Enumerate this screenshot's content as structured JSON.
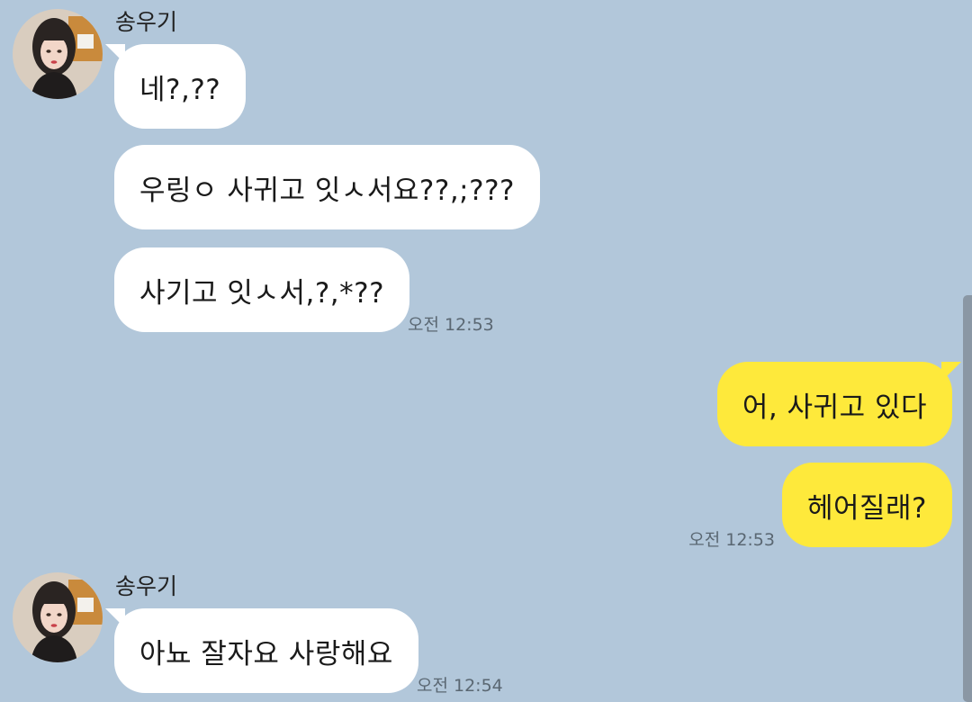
{
  "chat": {
    "groups": [
      {
        "sender": "송우기",
        "messages": [
          "네?,??",
          "우링ㅇ 사귀고 잇ㅅ서요??,;???",
          "사기고 잇ㅅ서,?,*??"
        ],
        "time": "오전 12:53"
      },
      {
        "sender": "me",
        "messages": [
          "어, 사귀고 있다",
          "헤어질래?"
        ],
        "time": "오전 12:53"
      },
      {
        "sender": "송우기",
        "messages": [
          "아뇨 잘자요 사랑해요"
        ],
        "time": "오전 12:54"
      }
    ]
  },
  "colors": {
    "background": "#b2c7da",
    "incoming_bubble": "#ffffff",
    "outgoing_bubble": "#fee93b"
  },
  "icons": {
    "avatar": "profile-photo"
  }
}
